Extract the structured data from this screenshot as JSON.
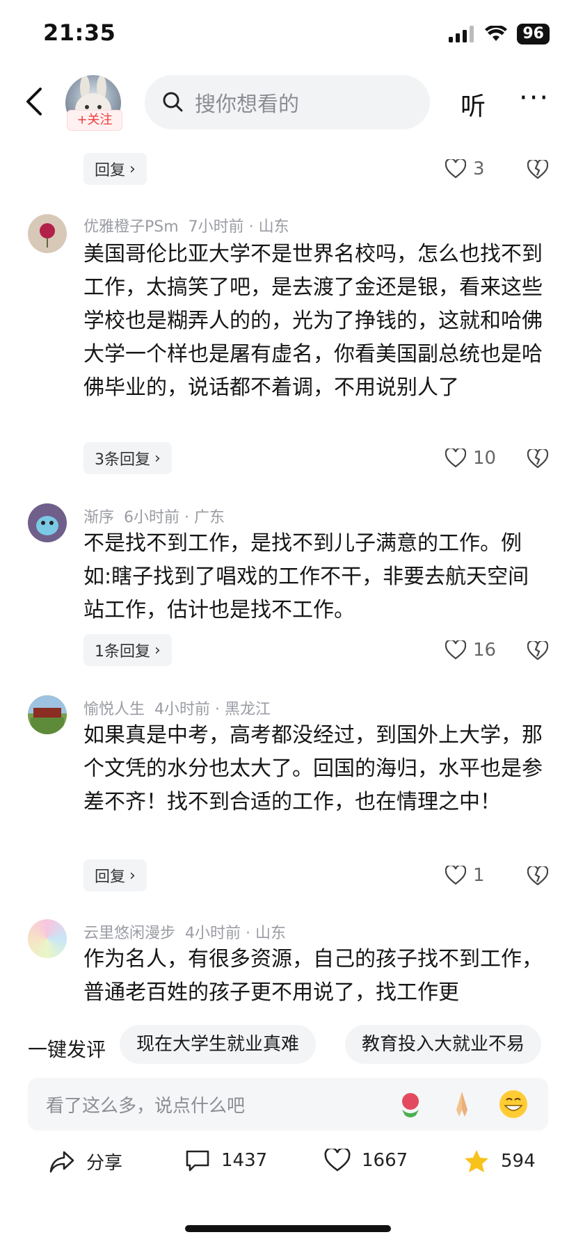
{
  "status_bar": {
    "time": "21:35",
    "battery": "96"
  },
  "header": {
    "follow_label": "+关注",
    "search_placeholder": "搜你想看的",
    "listen_label": "听",
    "more_label": "···"
  },
  "comments": [
    {
      "reply_label": "回复",
      "likes": "3"
    },
    {
      "user": "优雅橙子PSm",
      "meta": "7小时前 · 山东",
      "text": "美国哥伦比亚大学不是世界名校吗，怎么也找不到工作，太搞笑了吧，是去渡了金还是银，看来这些学校也是糊弄人的的，光为了挣钱的，这就和哈佛大学一个样也是屠有虚名，你看美国副总统也是哈佛毕业的，说话都不着调，不用说别人了",
      "reply_label": "3条回复",
      "likes": "10"
    },
    {
      "user": "渐序",
      "meta": "6小时前 · 广东",
      "text": "不是找不到工作，是找不到儿子满意的工作。例如:瞎子找到了唱戏的工作不干，非要去航天空间站工作，估计也是找不工作。",
      "reply_label": "1条回复",
      "likes": "16"
    },
    {
      "user": "愉悦人生",
      "meta": "4小时前 · 黑龙江",
      "text": "如果真是中考，高考都没经过，到国外上大学，那个文凭的水分也太大了。回国的海归，水平也是参差不齐！找不到合适的工作，也在情理之中！",
      "reply_label": "回复",
      "likes": "1"
    },
    {
      "user": "云里悠闲漫步",
      "meta": "4小时前 · 山东",
      "text": "作为名人，有很多资源，自己的孩子找不到工作，普通老百姓的孩子更不用说了，找工作更"
    }
  ],
  "quick_comment": {
    "label": "一键发评",
    "options": [
      "现在大学生就业真难",
      "教育投入大就业不易"
    ]
  },
  "input": {
    "placeholder": "看了这么多，说点什么吧"
  },
  "bottom_bar": {
    "share_label": "分享",
    "comments_count": "1437",
    "likes_count": "1667",
    "favorites_count": "594"
  },
  "colors": {
    "accent": "#f03b3b",
    "star": "#f7c21b"
  }
}
